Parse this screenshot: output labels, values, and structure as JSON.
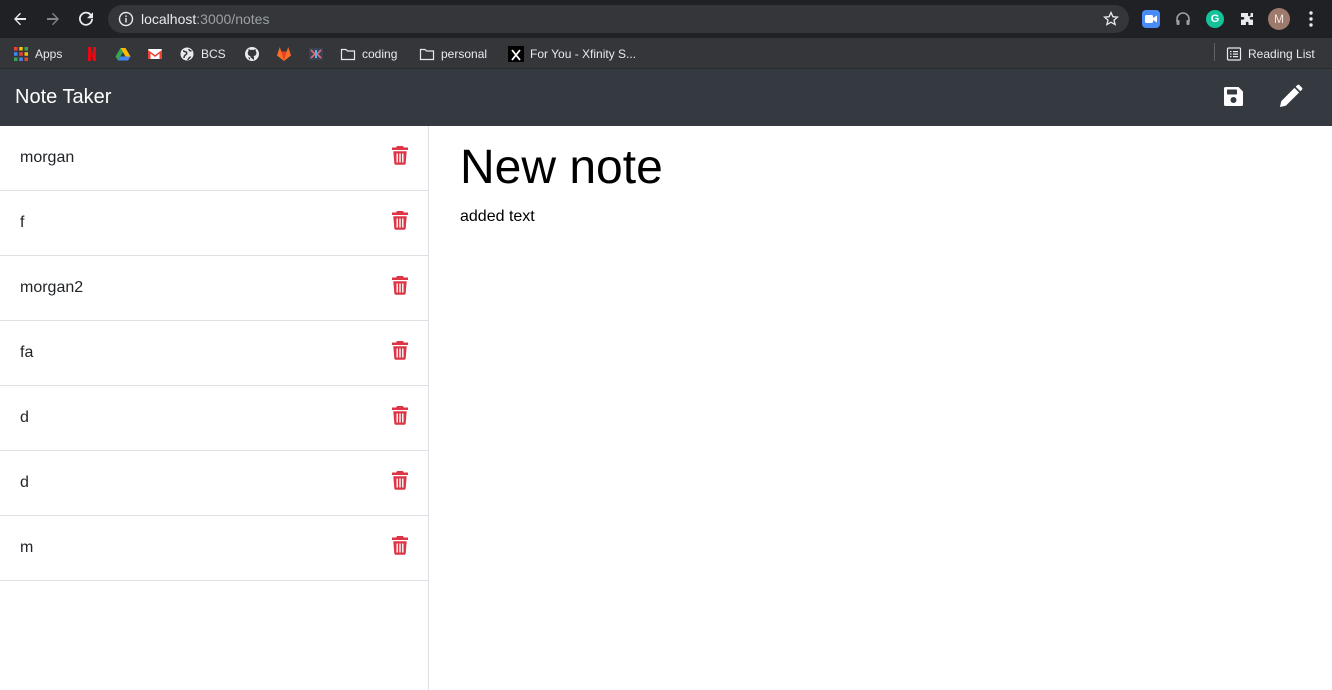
{
  "browser": {
    "url_host": "localhost",
    "url_path": ":3000/notes",
    "avatar_letter": "M",
    "bookmarks": {
      "apps": "Apps",
      "bcs": "BCS",
      "coding": "coding",
      "personal": "personal",
      "xfinity": "For You - Xfinity S...",
      "reading_list": "Reading List"
    }
  },
  "app": {
    "title": "Note Taker",
    "actions": {
      "save_icon": "floppy-disk-icon",
      "edit_icon": "pencil-icon"
    }
  },
  "notes": [
    {
      "title": "morgan"
    },
    {
      "title": "f"
    },
    {
      "title": "morgan2"
    },
    {
      "title": "fa"
    },
    {
      "title": "d"
    },
    {
      "title": "d"
    },
    {
      "title": "m"
    }
  ],
  "active_note": {
    "title": "New note",
    "text": "added text"
  },
  "colors": {
    "navbar": "#343a40",
    "delete": "#dc3545",
    "chrome": "#202124"
  }
}
